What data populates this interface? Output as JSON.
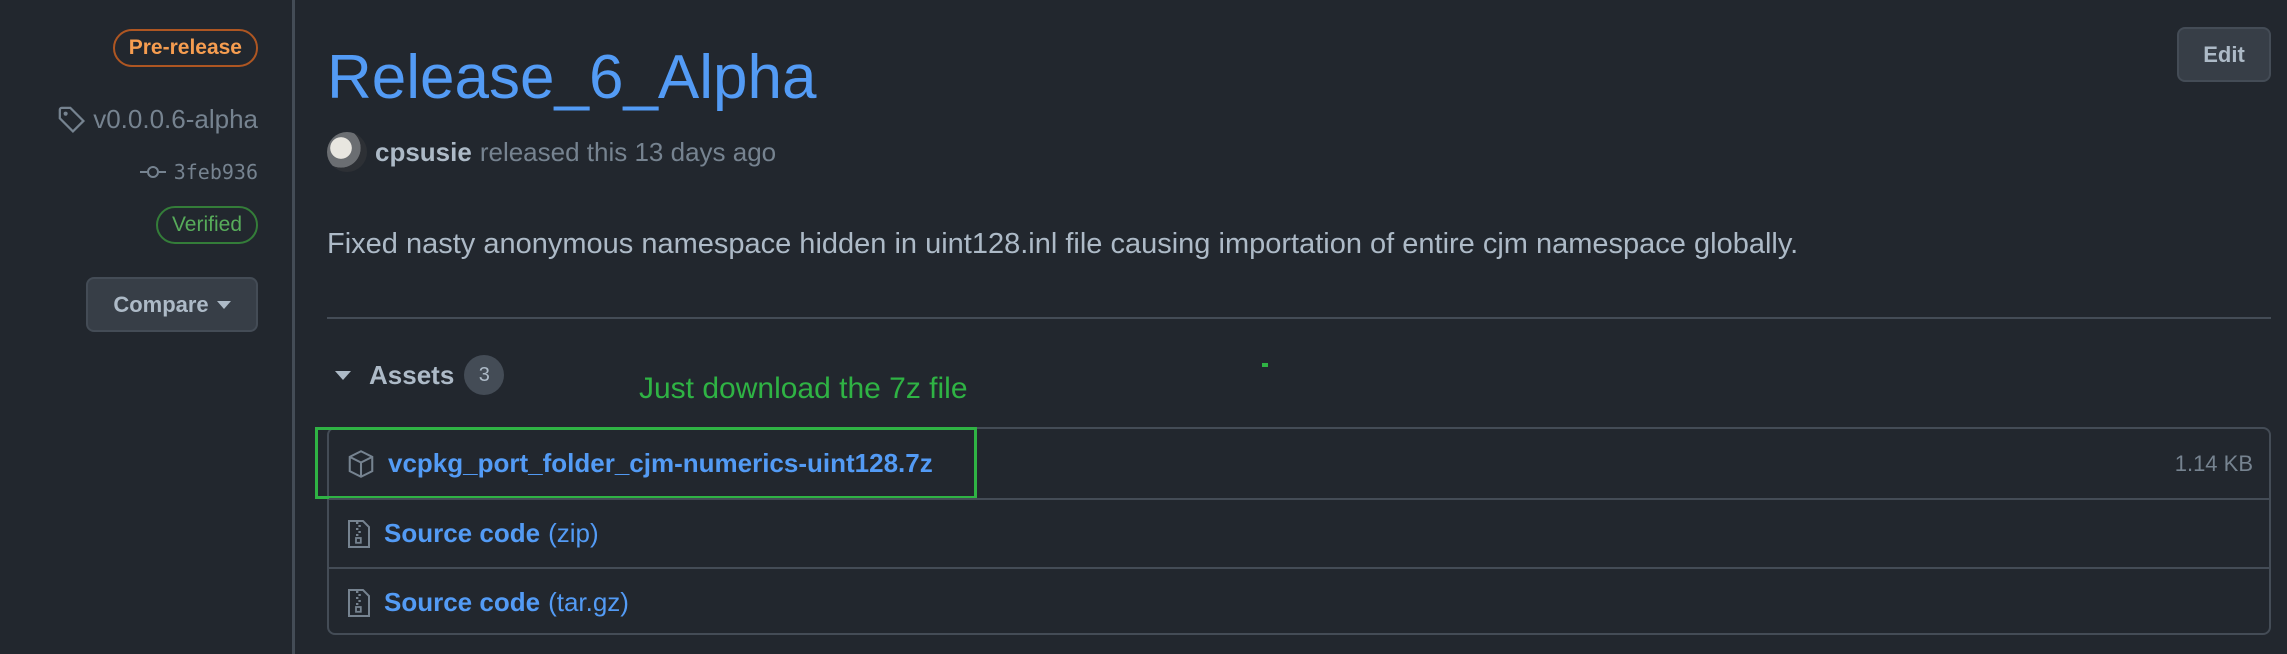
{
  "sidebar": {
    "pre_release_label": "Pre-release",
    "tag": "v0.0.0.6-alpha",
    "commit": "3feb936",
    "verified_label": "Verified",
    "compare_label": "Compare"
  },
  "release": {
    "title": "Release_6_Alpha",
    "edit_label": "Edit",
    "author": "cpsusie",
    "released_text": "released this 13 days ago",
    "body": "Fixed nasty anonymous namespace hidden in uint128.inl file causing importation of entire cjm namespace globally."
  },
  "assets": {
    "title": "Assets",
    "count": "3",
    "annotation": "Just download the 7z file",
    "items": [
      {
        "name": "vcpkg_port_folder_cjm-numerics-uint128.7z",
        "suffix": "",
        "size": "1.14 KB",
        "icon": "package-icon"
      },
      {
        "name": "Source code",
        "suffix": "(zip)",
        "size": "",
        "icon": "file-zip-icon"
      },
      {
        "name": "Source code",
        "suffix": "(tar.gz)",
        "size": "",
        "icon": "file-zip-icon"
      }
    ]
  },
  "colors": {
    "background": "#22272e",
    "link": "#539bf5",
    "pre_release": "#f69d50",
    "verified": "#57ab5a",
    "annotation": "#2fb344"
  }
}
